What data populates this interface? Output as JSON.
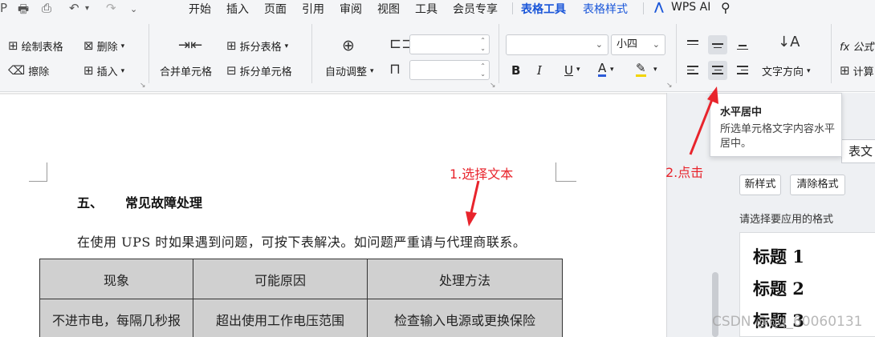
{
  "quick_access": [
    "P",
    "🖶",
    "⎙",
    "↶",
    "↷"
  ],
  "menu": {
    "items": [
      "开始",
      "插入",
      "页面",
      "引用",
      "审阅",
      "视图",
      "工具",
      "会员专享"
    ],
    "table_tools": "表格工具",
    "table_style": "表格样式",
    "ai": "WPS AI"
  },
  "ribbon": {
    "draw_table": "绘制表格",
    "delete": "删除",
    "erase": "擦除",
    "insert": "插入",
    "merge_cells": "合并单元格",
    "split_table": "拆分表格",
    "split_cells": "拆分单元格",
    "auto_fit": "自动调整",
    "font_size": "小四",
    "bold": "B",
    "italic": "I",
    "underline": "U",
    "font_color": "A",
    "highlight": "✎",
    "text_direction": "文字方向",
    "formula": "fx 公式",
    "calc": "计算"
  },
  "document": {
    "heading_num": "五、",
    "heading_text": "常见故障处理",
    "paragraph": "在使用 UPS 时如果遇到问题，可按下表解决。如问题严重请与代理商联系。",
    "table": {
      "headers": [
        "现象",
        "可能原因",
        "处理方法"
      ],
      "rows": [
        [
          "不进市电，每隔几秒报",
          "超出使用工作电压范围",
          "检查输入电源或更换保险"
        ]
      ]
    }
  },
  "tooltip": {
    "title": "水平居中",
    "body": "所选单元格文字内容水平居中。"
  },
  "pane": {
    "input_text": "表文",
    "new_style": "新样式",
    "clear_format": "清除格式",
    "apply_label": "请选择要应用的格式",
    "styles": [
      "标题 1",
      "标题 2",
      "标题 3"
    ]
  },
  "annotations": {
    "step1": "1.选择文本",
    "step2": "2.点击",
    "color": "#e8242c"
  },
  "watermark": "CSDN @qq_60060131"
}
